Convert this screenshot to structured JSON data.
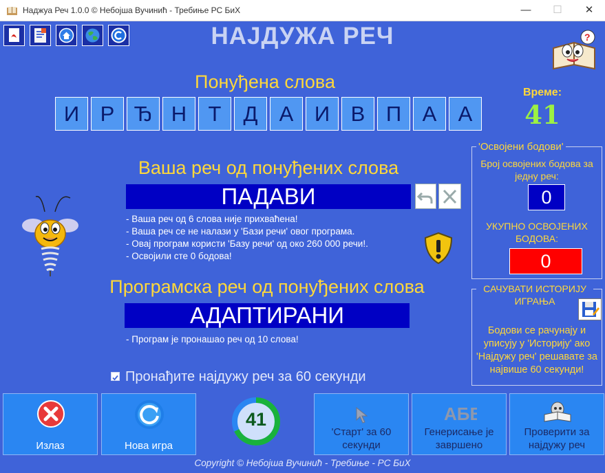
{
  "window": {
    "title": "Наджуа Реч 1.0.0   ©   Небојша Вучинић - Требиње РС БиХ",
    "minimize_glyph": "—",
    "maximize_glyph": "☐",
    "close_glyph": "✕"
  },
  "toolbar": {
    "icons": [
      "pdf-icon",
      "document-icon",
      "home-icon",
      "globe-icon",
      "copyright-icon"
    ]
  },
  "app_title": "НАЈДУЖА РЕЧ",
  "offered": {
    "heading": "Понуђена слова",
    "letters": [
      "И",
      "Р",
      "Ђ",
      "Н",
      "Т",
      "Д",
      "А",
      "И",
      "В",
      "П",
      "А",
      "А"
    ]
  },
  "timer": {
    "label": "Време:",
    "value": "41"
  },
  "user_word": {
    "heading": "Ваша реч од понуђених слова",
    "value": "ПАДАВИ",
    "messages": [
      "- Ваша реч од 6 слова није прихваћена!",
      "- Ваша реч се не налази у 'Бази речи' овог програма.",
      "- Овај програм користи 'Базу речи' од око 260 000 речи!.",
      "- Освојили сте 0 бодова!"
    ]
  },
  "program_word": {
    "heading": "Програмска реч од понуђених слова",
    "value": "АДАПТИРАНИ",
    "message": "- Програм је пронашао реч од 10 слова!"
  },
  "points": {
    "legend": "'Освојени бодови'",
    "word_label": "Број освојених бодова за једну реч:",
    "word_value": "0",
    "total_label": "УКУПНО ОСВОЈЕНИХ БОДОВА:",
    "total_value": "0"
  },
  "history": {
    "legend": "САЧУВАТИ ИСТОРИЈУ ИГРАЊА",
    "note": "Бодови се рачунају и уписују у 'Историју' ако 'Најдужу реч' решавате за највише 60 секунди!"
  },
  "checkbox": {
    "label": "Пронађите најдужу реч за 60 секунди",
    "checked": true
  },
  "buttons": {
    "exit": "Излаз",
    "new_game": "Нова игра",
    "start": "'Старт' за 60 секунди",
    "generate": "Генерисање је завршено",
    "check": "Проверити за најдужу реч"
  },
  "countdown": {
    "value": "41",
    "remaining_fraction": 0.68
  },
  "footer": "Copyright © Небојша Вучинић - Требиње - РС БиХ",
  "colors": {
    "background": "#3f63d9",
    "heading_yellow": "#ffd83a",
    "word_box": "#0000c4",
    "letter_tile": "#5097f2",
    "timer_green": "#9cf043",
    "total_red": "#ff0000",
    "button_blue": "#2a86f2"
  }
}
